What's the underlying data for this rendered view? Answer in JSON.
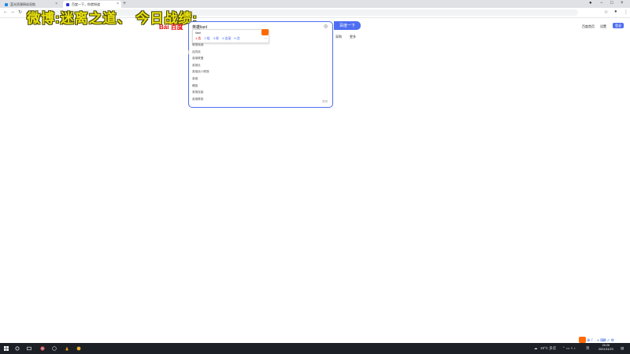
{
  "browser": {
    "tabs": [
      {
        "title": "蓝光资源网站导航",
        "active": false
      },
      {
        "title": "百度一下，你就知道",
        "active": true
      }
    ],
    "new_tab": "+",
    "tab_close": "×"
  },
  "overlay_caption": "微博:迷离之道、 今日战绩:",
  "baidu": {
    "logo_text": "Bai 百度",
    "search_query": "英雄lianl",
    "ime": {
      "pinyin": "lianl",
      "candidates": [
        "1.恋",
        "2.链",
        "3.联",
        "4.连接",
        "5.恋"
      ],
      "nav": "‹ ›"
    },
    "suggestions": [
      "联想商城",
      "连同效",
      "英雄联盟",
      "英雄社",
      "英雄战人联报",
      "英雄",
      "螺旋",
      "英雄连接",
      "英雄联络"
    ],
    "suggest_close": "关闭",
    "search_button": "百度一下",
    "links": [
      "采购",
      "更多"
    ],
    "top_links": [
      "百度首页",
      "设置"
    ],
    "login": "登录"
  },
  "taskbar": {
    "weather": "19°C 多云",
    "lang": "英",
    "time": "20:26",
    "date": "2021/11/23"
  }
}
